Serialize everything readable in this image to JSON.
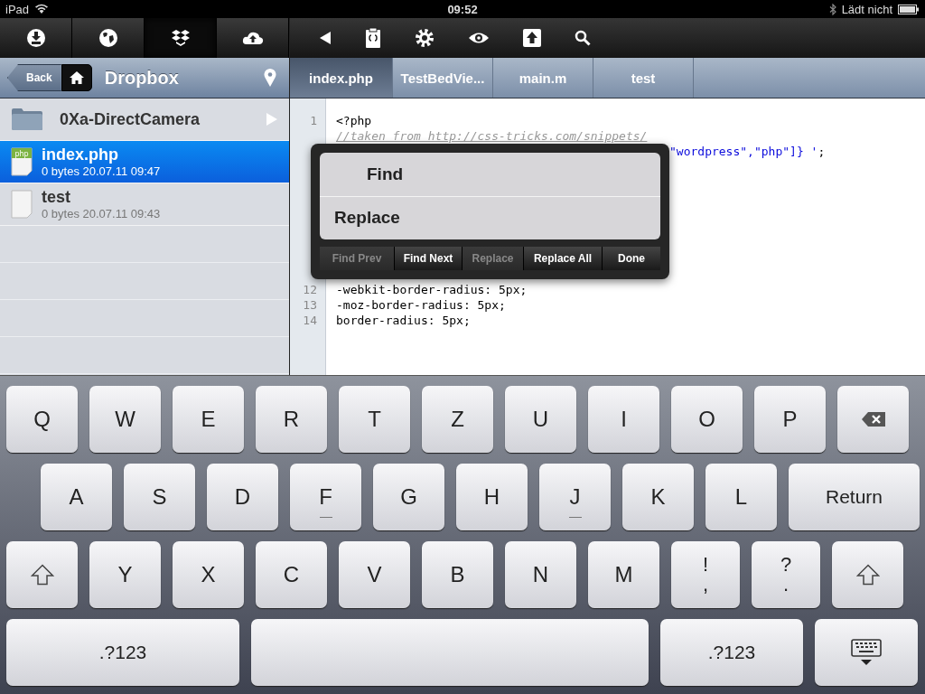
{
  "status_bar": {
    "device": "iPad",
    "time": "09:52",
    "charging": "Lädt nicht"
  },
  "sidebar_toolbar": [
    {
      "kind": "download",
      "selected": false
    },
    {
      "kind": "globe",
      "selected": false
    },
    {
      "kind": "dropbox",
      "selected": true
    },
    {
      "kind": "cloud",
      "selected": false
    }
  ],
  "editor_toolbar": [
    {
      "kind": "back"
    },
    {
      "kind": "clipboard"
    },
    {
      "kind": "gear"
    },
    {
      "kind": "eye"
    },
    {
      "kind": "upload"
    },
    {
      "kind": "search"
    }
  ],
  "nav": {
    "back": "Back",
    "title": "Dropbox"
  },
  "files": [
    {
      "kind": "folder",
      "name": "0Xa-DirectCamera",
      "selected": false
    },
    {
      "kind": "php",
      "name": "index.php",
      "info": "0 bytes 20.07.11 09:47",
      "selected": true
    },
    {
      "kind": "file",
      "name": "test",
      "info": "0 bytes 20.07.11 09:43",
      "selected": false
    }
  ],
  "tabs": [
    {
      "label": "index.php",
      "selected": true
    },
    {
      "label": "TestBedVie...",
      "selected": false
    },
    {
      "label": "main.m",
      "selected": false
    },
    {
      "label": "test",
      "selected": false
    }
  ],
  "code_top": [
    {
      "number": "1",
      "covered": false,
      "parts": [
        {
          "kind": "plain",
          "text": "<?php"
        }
      ]
    },
    {
      "covered": false,
      "parts": [
        {
          "kind": "comment",
          "text": "//taken from http://css-tricks.com/snippets/"
        }
      ]
    },
    {
      "covered": true,
      "parts": [
        {
          "kind": "string",
          "text": "\"wordpress\",\"php\"]} '"
        },
        {
          "kind": "plain",
          "text": ";"
        }
      ]
    }
  ],
  "code_bottom": [
    {
      "number": "12",
      "parts": [
        {
          "kind": "plain",
          "text": "-webkit-border-radius: 5px;"
        }
      ]
    },
    {
      "number": "13",
      "parts": [
        {
          "kind": "plain",
          "text": "-moz-border-radius: 5px;"
        }
      ]
    },
    {
      "number": "14",
      "parts": [
        {
          "kind": "plain",
          "text": "border-radius: 5px;"
        }
      ]
    }
  ],
  "find_popup": {
    "find_placeholder": "Find",
    "replace_placeholder": "Replace",
    "buttons": [
      {
        "label": "Find Prev",
        "disabled": true
      },
      {
        "label": "Find Next",
        "disabled": false
      },
      {
        "label": "Replace",
        "disabled": true
      },
      {
        "label": "Replace All",
        "disabled": false
      },
      {
        "label": "Done",
        "disabled": false
      }
    ]
  },
  "keyboard": [
    [
      {
        "kind": "letter",
        "label": "Q"
      },
      {
        "kind": "letter",
        "label": "W"
      },
      {
        "kind": "letter",
        "label": "E"
      },
      {
        "kind": "letter",
        "label": "R"
      },
      {
        "kind": "letter",
        "label": "T"
      },
      {
        "kind": "letter",
        "label": "Z"
      },
      {
        "kind": "letter",
        "label": "U"
      },
      {
        "kind": "letter",
        "label": "I"
      },
      {
        "kind": "letter",
        "label": "O"
      },
      {
        "kind": "letter",
        "label": "P"
      },
      {
        "kind": "backspace"
      }
    ],
    [
      {
        "kind": "letter",
        "label": "A"
      },
      {
        "kind": "letter",
        "label": "S"
      },
      {
        "kind": "letter",
        "label": "D"
      },
      {
        "kind": "letter",
        "label": "F",
        "bump": true
      },
      {
        "kind": "letter",
        "label": "G"
      },
      {
        "kind": "letter",
        "label": "H"
      },
      {
        "kind": "letter",
        "label": "J",
        "bump": true
      },
      {
        "kind": "letter",
        "label": "K"
      },
      {
        "kind": "letter",
        "label": "L"
      },
      {
        "kind": "return",
        "label": "Return"
      }
    ],
    [
      {
        "kind": "shift"
      },
      {
        "kind": "letter",
        "label": "Y"
      },
      {
        "kind": "letter",
        "label": "X"
      },
      {
        "kind": "letter",
        "label": "C"
      },
      {
        "kind": "letter",
        "label": "V"
      },
      {
        "kind": "letter",
        "label": "B"
      },
      {
        "kind": "letter",
        "label": "N"
      },
      {
        "kind": "letter",
        "label": "M"
      },
      {
        "kind": "dual",
        "top": "!",
        "bottom": ","
      },
      {
        "kind": "dual",
        "top": "?",
        "bottom": "."
      },
      {
        "kind": "shift"
      }
    ],
    [
      {
        "kind": "numbers",
        "label": ".?123"
      },
      {
        "kind": "space"
      },
      {
        "kind": "numbers",
        "label": ".?123"
      },
      {
        "kind": "hide"
      }
    ]
  ]
}
